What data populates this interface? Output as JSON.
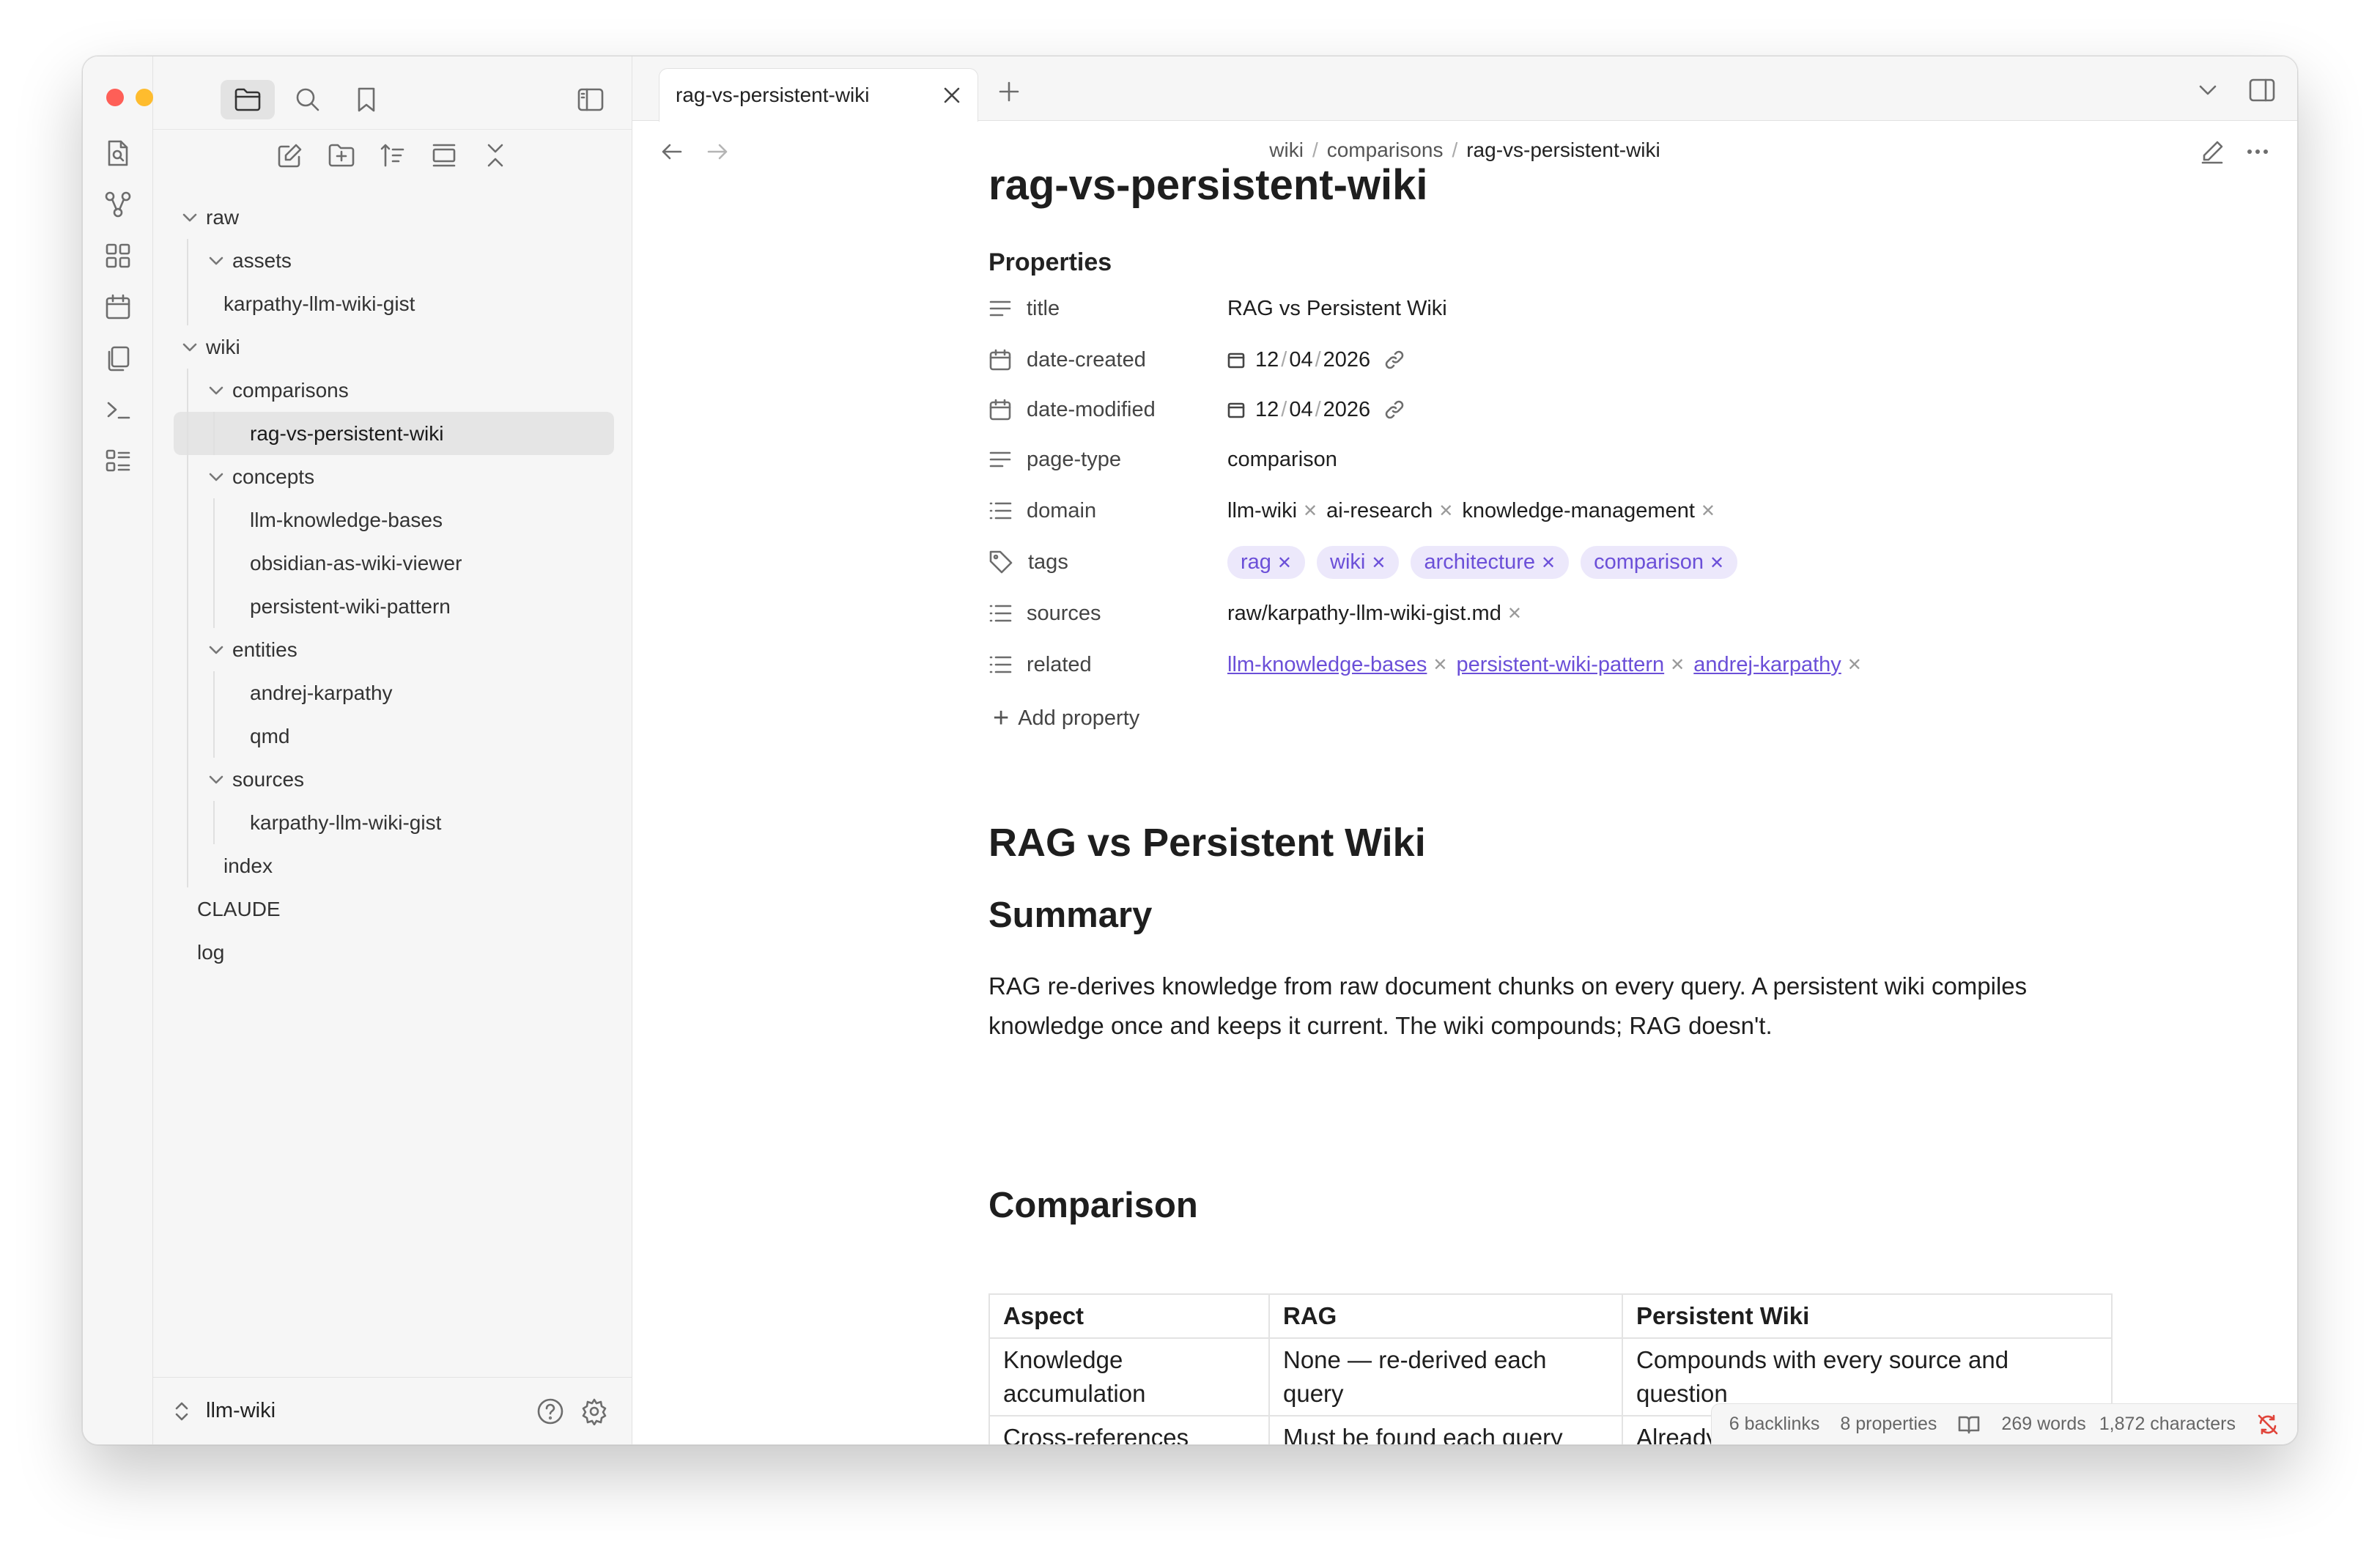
{
  "sidebar": {
    "tree": [
      {
        "label": "raw",
        "depth": 0,
        "type": "folder",
        "expanded": true
      },
      {
        "label": "assets",
        "depth": 1,
        "type": "folder",
        "expanded": true
      },
      {
        "label": "karpathy-llm-wiki-gist",
        "depth": 1,
        "type": "file"
      },
      {
        "label": "wiki",
        "depth": 0,
        "type": "folder",
        "expanded": true
      },
      {
        "label": "comparisons",
        "depth": 1,
        "type": "folder",
        "expanded": true
      },
      {
        "label": "rag-vs-persistent-wiki",
        "depth": 2,
        "type": "file",
        "selected": true
      },
      {
        "label": "concepts",
        "depth": 1,
        "type": "folder",
        "expanded": true
      },
      {
        "label": "llm-knowledge-bases",
        "depth": 2,
        "type": "file"
      },
      {
        "label": "obsidian-as-wiki-viewer",
        "depth": 2,
        "type": "file"
      },
      {
        "label": "persistent-wiki-pattern",
        "depth": 2,
        "type": "file"
      },
      {
        "label": "entities",
        "depth": 1,
        "type": "folder",
        "expanded": true
      },
      {
        "label": "andrej-karpathy",
        "depth": 2,
        "type": "file"
      },
      {
        "label": "qmd",
        "depth": 2,
        "type": "file"
      },
      {
        "label": "sources",
        "depth": 1,
        "type": "folder",
        "expanded": true
      },
      {
        "label": "karpathy-llm-wiki-gist",
        "depth": 2,
        "type": "file"
      },
      {
        "label": "index",
        "depth": 1,
        "type": "file"
      },
      {
        "label": "CLAUDE",
        "depth": 0,
        "type": "file"
      },
      {
        "label": "log",
        "depth": 0,
        "type": "file"
      }
    ],
    "vault_name": "llm-wiki"
  },
  "tab": {
    "label": "rag-vs-persistent-wiki"
  },
  "breadcrumb": {
    "part1": "wiki",
    "part2": "comparisons",
    "part3": "rag-vs-persistent-wiki",
    "sep": "/"
  },
  "note": {
    "title": "rag-vs-persistent-wiki",
    "properties_heading": "Properties",
    "properties": {
      "title": {
        "key": "title",
        "value": "RAG vs Persistent Wiki"
      },
      "date_created": {
        "key": "date-created",
        "d": "12",
        "m": "04",
        "y": "2026"
      },
      "date_modified": {
        "key": "date-modified",
        "d": "12",
        "m": "04",
        "y": "2026"
      },
      "page_type": {
        "key": "page-type",
        "value": "comparison"
      },
      "domain": {
        "key": "domain",
        "values": [
          "llm-wiki",
          "ai-research",
          "knowledge-management"
        ]
      },
      "tags": {
        "key": "tags",
        "values": [
          "rag",
          "wiki",
          "architecture",
          "comparison"
        ]
      },
      "sources": {
        "key": "sources",
        "values": [
          "raw/karpathy-llm-wiki-gist.md"
        ]
      },
      "related": {
        "key": "related",
        "values": [
          "llm-knowledge-bases",
          "persistent-wiki-pattern",
          "andrej-karpathy"
        ]
      }
    },
    "add_property": "Add property",
    "h1": "RAG vs Persistent Wiki",
    "summary_heading": "Summary",
    "summary_text": "RAG re-derives knowledge from raw document chunks on every query. A persistent wiki compiles knowledge once and keeps it current. The wiki compounds; RAG doesn't.",
    "comparison_heading": "Comparison",
    "table": {
      "headers": [
        "Aspect",
        "RAG",
        "Persistent Wiki"
      ],
      "rows": [
        [
          "Knowledge accumulation",
          "None — re-derived each query",
          "Compounds with every source and question"
        ],
        [
          "Cross-references",
          "Must be found each query",
          "Already"
        ]
      ]
    }
  },
  "status": {
    "backlinks": "6 backlinks",
    "properties": "8 properties",
    "words": "269 words",
    "characters": "1,872 characters"
  },
  "colors": {
    "accent": "#6b4fd8",
    "tag_bg": "#ece8fb",
    "close": "#fe5f57",
    "minimize": "#febc2e",
    "zoom": "#28c840"
  }
}
